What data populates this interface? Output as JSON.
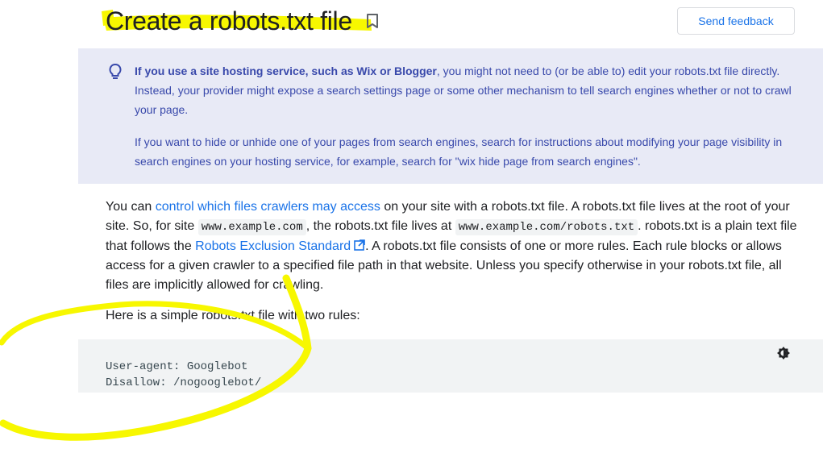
{
  "header": {
    "title": "Create a robots.txt file",
    "feedback_label": "Send feedback"
  },
  "callout": {
    "p1_bold": "If you use a site hosting service, such as Wix or Blogger",
    "p1_rest": ", you might not need to (or be able to) edit your robots.txt file directly. Instead, your provider might expose a search settings page or some other mechanism to tell search engines whether or not to crawl your page.",
    "p2": "If you want to hide or unhide one of your pages from search engines, search for instructions about modifying your page visibility in search engines on your hosting service, for example, search for \"wix hide page from search engines\"."
  },
  "body": {
    "t1": "You can ",
    "link1": "control which files crawlers may access",
    "t2": " on your site with a robots.txt file. A robots.txt file lives at the root of your site. So, for site ",
    "code1": "www.example.com",
    "t3": ", the robots.txt file lives at ",
    "code2": "www.example.com/robots.txt",
    "t4": ". robots.txt is a plain text file that follows the ",
    "link2": "Robots Exclusion Standard",
    "t5": ". A robots.txt file consists of one or more rules. Each rule blocks or allows access for a given crawler to a specified file path in that website. Unless you specify otherwise in your robots.txt file, all files are implicitly allowed for crawling."
  },
  "intro": "Here is a simple robots.txt file with two rules:",
  "code_block": {
    "line1": "User-agent: Googlebot",
    "line2": "Disallow: /nogooglebot/"
  },
  "colors": {
    "highlight": "#f7f700",
    "link": "#1a73e8",
    "callout_bg": "#e8eaf6",
    "callout_text": "#3949ab"
  },
  "icons": [
    "bookmark-icon",
    "lightbulb-icon",
    "external-link-icon",
    "theme-toggle-icon"
  ]
}
